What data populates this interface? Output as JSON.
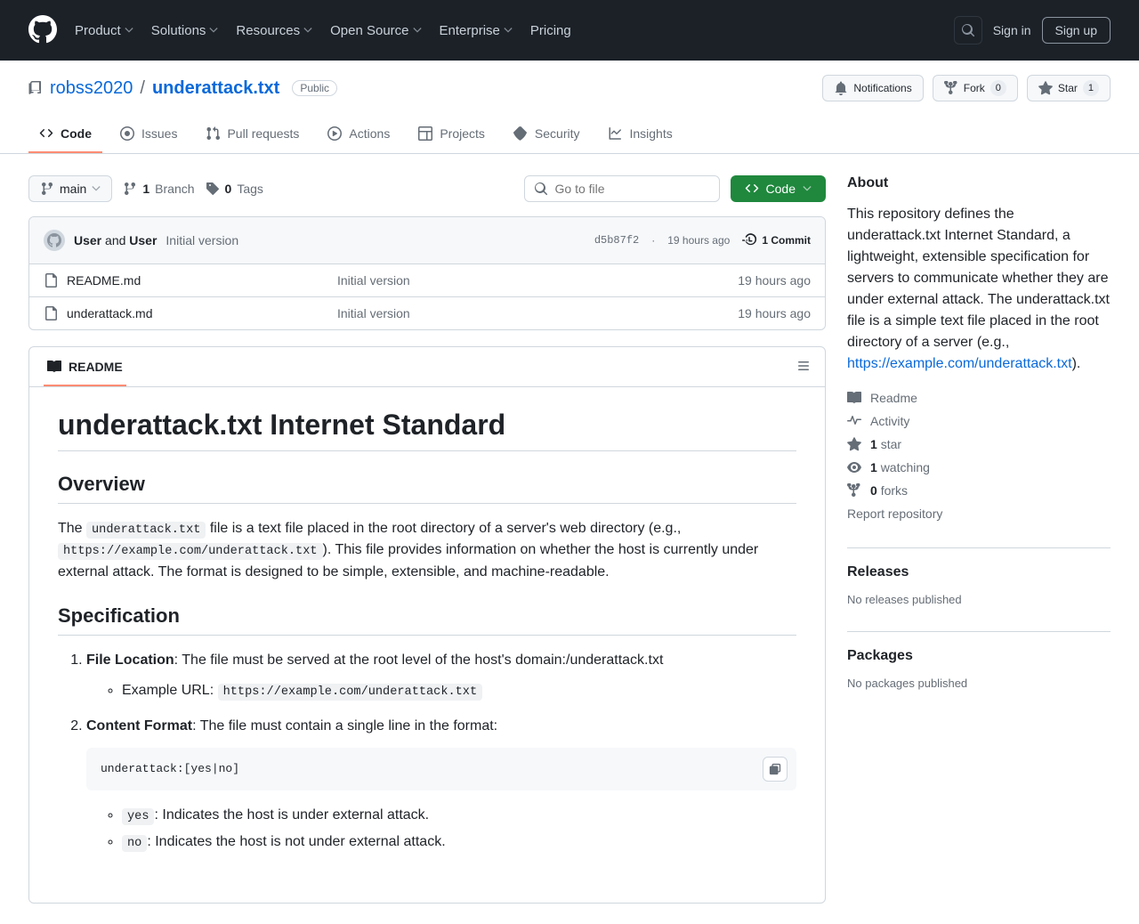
{
  "topnav": {
    "items": [
      "Product",
      "Solutions",
      "Resources",
      "Open Source",
      "Enterprise",
      "Pricing"
    ],
    "signin": "Sign in",
    "signup": "Sign up"
  },
  "repo": {
    "owner": "robss2020",
    "name": "underattack.txt",
    "visibility": "Public"
  },
  "actions": {
    "notifications": "Notifications",
    "fork": "Fork",
    "fork_count": "0",
    "star": "Star",
    "star_count": "1"
  },
  "tabs": [
    "Code",
    "Issues",
    "Pull requests",
    "Actions",
    "Projects",
    "Security",
    "Insights"
  ],
  "branchbar": {
    "branch": "main",
    "branch_count": "1",
    "branch_label": "Branch",
    "tag_count": "0",
    "tag_label": "Tags",
    "goto_placeholder": "Go to file",
    "code_btn": "Code"
  },
  "commit": {
    "user1": "User",
    "and": "and",
    "user2": "User",
    "message": "Initial version",
    "sha": "d5b87f2",
    "sep": "·",
    "age": "19 hours ago",
    "count": "1 Commit"
  },
  "files": [
    {
      "name": "README.md",
      "msg": "Initial version",
      "age": "19 hours ago"
    },
    {
      "name": "underattack.md",
      "msg": "Initial version",
      "age": "19 hours ago"
    }
  ],
  "readme": {
    "tab": "README",
    "h1": "underattack.txt Internet Standard",
    "h2_overview": "Overview",
    "p_ov_1": "The ",
    "p_ov_code1": "underattack.txt",
    "p_ov_2": " file is a text file placed in the root directory of a server's web directory (e.g., ",
    "p_ov_code2": "https://example.com/underattack.txt",
    "p_ov_3": "). This file provides information on whether the host is currently under external attack. The format is designed to be simple, extensible, and machine-readable.",
    "h2_spec": "Specification",
    "li1_b": "File Location",
    "li1_t": ": The file must be served at the root level of the host's domain:/underattack.txt",
    "li1_sub_pre": "Example URL: ",
    "li1_sub_code": "https://example.com/underattack.txt",
    "li2_b": "Content Format",
    "li2_t": ": The file must contain a single line in the format:",
    "codeblock": "underattack:[yes|no]",
    "li2_sub1_code": "yes",
    "li2_sub1_t": ": Indicates the host is under external attack.",
    "li2_sub2_code": "no",
    "li2_sub2_t": ": Indicates the host is not under external attack."
  },
  "about": {
    "heading": "About",
    "text1": "This repository defines the underattack.txt Internet Standard, a lightweight, extensible specification for servers to communicate whether they are under external attack. The underattack.txt file is a simple text file placed in the root directory of a server (e.g., ",
    "link": "https://example.com/underattack.txt",
    "text2": ").",
    "readme": "Readme",
    "activity": "Activity",
    "stars_n": "1",
    "stars_l": "star",
    "watch_n": "1",
    "watch_l": "watching",
    "forks_n": "0",
    "forks_l": "forks",
    "report": "Report repository",
    "releases_h": "Releases",
    "releases_t": "No releases published",
    "packages_h": "Packages",
    "packages_t": "No packages published"
  }
}
